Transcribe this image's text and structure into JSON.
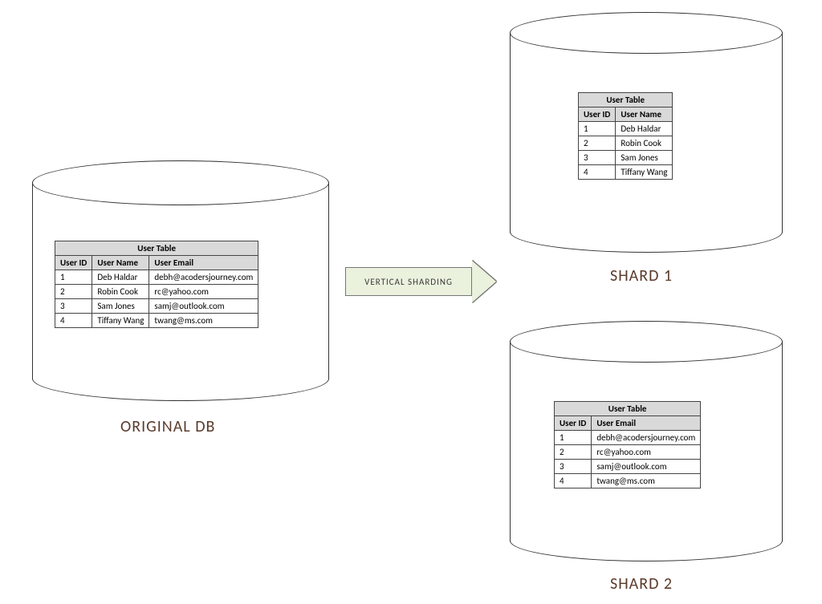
{
  "arrow_label": "VERTICAL SHARDING",
  "labels": {
    "original": "ORIGINAL DB",
    "shard1": "SHARD 1",
    "shard2": "SHARD 2"
  },
  "original": {
    "title": "User Table",
    "headers": [
      "User ID",
      "User Name",
      "User Email"
    ],
    "rows": [
      [
        "1",
        "Deb Haldar",
        "debh@acodersjourney.com"
      ],
      [
        "2",
        "Robin Cook",
        "rc@yahoo.com"
      ],
      [
        "3",
        "Sam Jones",
        "samj@outlook.com"
      ],
      [
        "4",
        "Tiffany Wang",
        "twang@ms.com"
      ]
    ]
  },
  "shard1": {
    "title": "User Table",
    "headers": [
      "User ID",
      "User Name"
    ],
    "rows": [
      [
        "1",
        "Deb Haldar"
      ],
      [
        "2",
        "Robin Cook"
      ],
      [
        "3",
        "Sam Jones"
      ],
      [
        "4",
        "Tiffany Wang"
      ]
    ]
  },
  "shard2": {
    "title": "User Table",
    "headers": [
      "User ID",
      "User Email"
    ],
    "rows": [
      [
        "1",
        "debh@acodersjourney.com"
      ],
      [
        "2",
        "rc@yahoo.com"
      ],
      [
        "3",
        "samj@outlook.com"
      ],
      [
        "4",
        "twang@ms.com"
      ]
    ]
  }
}
